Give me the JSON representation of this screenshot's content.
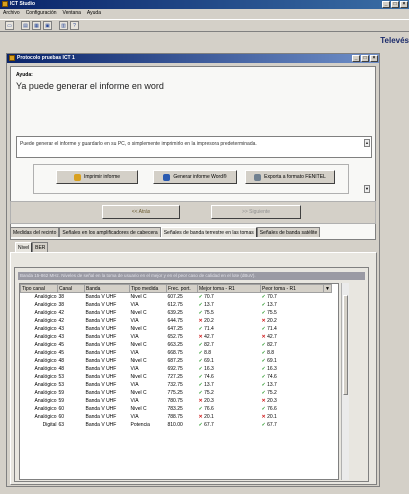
{
  "app": {
    "title": "ICT Studio"
  },
  "menu": [
    "Archivo",
    "Configuración",
    "Ventana",
    "Ayuda"
  ],
  "brand": "Televés",
  "dialog": {
    "title": "Protocolo pruebas ICT 1",
    "help_heading": "Ayuda:",
    "help_message": "Ya puede generar el informe en word",
    "info_text": "Puede generar el informe y guardarlo en su PC, o simplemente imprimirlo en la impresora predeterminada.",
    "buttons": {
      "print": "Imprimir informe",
      "word": "Generar informe Word®",
      "fenitel": "Exporta a formato FENITEL"
    },
    "nav": {
      "back": "<< Atrás",
      "next": ">> Siguiente"
    }
  },
  "tabs": [
    "Medidas del recinto",
    "Señales en los amplificadores de cabecera",
    "Señales de banda terrestre en las tomas",
    "Señales de banda satélite"
  ],
  "active_tab": 2,
  "subtabs": [
    "Nivel",
    "BER"
  ],
  "banner": "Banda 15-862 MHz. Niveles de señal en la toma de usuario en el mejor y en el peor caso de calidad en el lote (dBuV).",
  "table": {
    "headers": [
      "Tipo canal",
      "Canal",
      "Banda",
      "Tipo medida",
      "Frec. port.",
      "Mejor toma - R1",
      "Peor toma - R1"
    ],
    "rows": [
      [
        "Analógico",
        "38",
        "Banda V UHF",
        "Nivel C",
        "607.25",
        "ok",
        "70.7",
        "ok",
        "70.7"
      ],
      [
        "Analógico",
        "38",
        "Banda V UHF",
        "V/A",
        "612.75",
        "ok",
        "13.7",
        "ok",
        "13.7"
      ],
      [
        "Analógico",
        "42",
        "Banda V UHF",
        "Nivel C",
        "639.25",
        "ok",
        "75.5",
        "ok",
        "75.5"
      ],
      [
        "Analógico",
        "42",
        "Banda V UHF",
        "V/A",
        "644.75",
        "ko",
        "20.2",
        "ko",
        "20.2"
      ],
      [
        "Analógico",
        "43",
        "Banda V UHF",
        "Nivel C",
        "647.25",
        "ok",
        "71.4",
        "ok",
        "71.4"
      ],
      [
        "Analógico",
        "43",
        "Banda V UHF",
        "V/A",
        "652.75",
        "ko",
        "42.7",
        "ko",
        "42.7"
      ],
      [
        "Analógico",
        "45",
        "Banda V UHF",
        "Nivel C",
        "663.25",
        "ok",
        "82.7",
        "ok",
        "82.7"
      ],
      [
        "Analógico",
        "45",
        "Banda V UHF",
        "V/A",
        "668.75",
        "ok",
        "8.8",
        "ok",
        "8.8"
      ],
      [
        "Analógico",
        "48",
        "Banda V UHF",
        "Nivel C",
        "687.25",
        "ok",
        "69.1",
        "ok",
        "69.1"
      ],
      [
        "Analógico",
        "48",
        "Banda V UHF",
        "V/A",
        "692.75",
        "ok",
        "16.3",
        "ok",
        "16.3"
      ],
      [
        "Analógico",
        "53",
        "Banda V UHF",
        "Nivel C",
        "727.25",
        "ok",
        "74.6",
        "ok",
        "74.6"
      ],
      [
        "Analógico",
        "53",
        "Banda V UHF",
        "V/A",
        "732.75",
        "ok",
        "13.7",
        "ok",
        "13.7"
      ],
      [
        "Analógico",
        "59",
        "Banda V UHF",
        "Nivel C",
        "775.25",
        "ok",
        "75.2",
        "ok",
        "75.2"
      ],
      [
        "Analógico",
        "59",
        "Banda V UHF",
        "V/A",
        "780.75",
        "ko",
        "20.3",
        "ko",
        "20.3"
      ],
      [
        "Analógico",
        "60",
        "Banda V UHF",
        "Nivel C",
        "783.25",
        "ok",
        "76.6",
        "ok",
        "76.6"
      ],
      [
        "Analógico",
        "60",
        "Banda V UHF",
        "V/A",
        "788.75",
        "ko",
        "20.1",
        "ko",
        "20.1"
      ],
      [
        "Digital",
        "63",
        "Banda V UHF",
        "Potencia",
        "810.00",
        "ok",
        "67.7",
        "ok",
        "67.7"
      ]
    ]
  },
  "colors": {
    "title_bar": "#0a246a",
    "ok": "#2a9a2a",
    "ko": "#d01818"
  }
}
